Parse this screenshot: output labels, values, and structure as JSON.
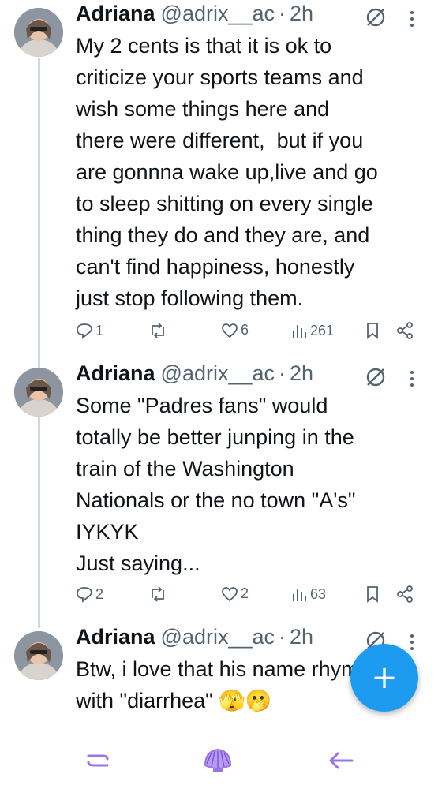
{
  "tweets": [
    {
      "name": "Adriana",
      "handle": "@adrix__ac",
      "separator": "·",
      "time": "2h",
      "text": "My 2 cents is that it is ok to\ncriticize your sports teams and\nwish some things here and\nthere were different,  but if you\nare gonnna wake up,live and go\nto sleep shitting on every single\nthing they do and they are, and\ncan't find happiness, honestly\njust stop following them.",
      "replies": "1",
      "reposts": "",
      "likes": "6",
      "views": "261"
    },
    {
      "name": "Adriana",
      "handle": "@adrix__ac",
      "separator": "·",
      "time": "2h",
      "text": "Some \"Padres fans\" would\ntotally be better junping in the\ntrain of the Washington\nNationals or the no town \"A's\"\nIYKYK\nJust saying...",
      "replies": "2",
      "reposts": "",
      "likes": "2",
      "views": "63"
    },
    {
      "name": "Adriana",
      "handle": "@adrix__ac",
      "separator": "·",
      "time": "2h",
      "text": "Btw, i love that his name rhymes\nwith \"diarrhea\" 🫣🫢"
    }
  ],
  "compose_button": "+",
  "icons": {
    "reply": "reply-icon",
    "repost": "repost-icon",
    "like": "heart-icon",
    "views": "views-icon",
    "bookmark": "bookmark-icon",
    "share": "share-icon",
    "grok": "grok-icon",
    "more": "more-icon"
  },
  "colors": {
    "accent": "#1d9bf0",
    "text": "#0f1419",
    "muted": "#536471",
    "nav_icons": "#9b72e8"
  }
}
